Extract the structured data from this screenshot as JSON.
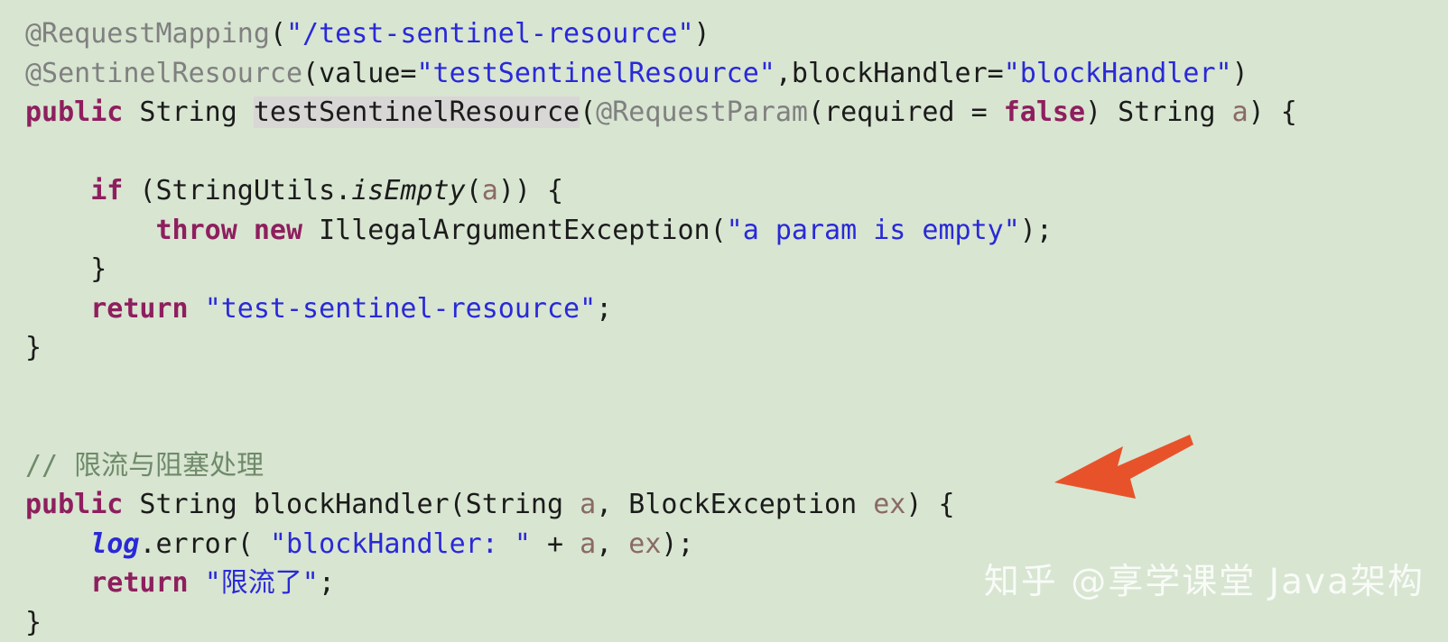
{
  "editor": {
    "background_color": "#d8e5d1",
    "language": "java",
    "font_size_px": 30,
    "theme_colors": {
      "annotation": "#808080",
      "keyword": "#8e1f5e",
      "string": "#2929d8",
      "comment": "#6e8a6a",
      "parameter": "#8a6a63",
      "static_field": "#2929d8",
      "default_text": "#1b1b1b",
      "declaration_highlight": "#d9d6d6"
    }
  },
  "code": {
    "lines": [
      {
        "id": "line-1",
        "plain": "@RequestMapping(\"/test-sentinel-resource\")",
        "tokens": [
          {
            "text": "@RequestMapping",
            "type": "annotation"
          },
          {
            "text": "(",
            "type": "punct"
          },
          {
            "text": "\"/test-sentinel-resource\"",
            "type": "string"
          },
          {
            "text": ")",
            "type": "punct"
          }
        ]
      },
      {
        "id": "line-2",
        "plain": "@SentinelResource(value=\"testSentinelResource\",blockHandler=\"blockHandler\")",
        "tokens": [
          {
            "text": "@SentinelResource",
            "type": "annotation"
          },
          {
            "text": "(value=",
            "type": "punct"
          },
          {
            "text": "\"testSentinelResource\"",
            "type": "string"
          },
          {
            "text": ",blockHandler=",
            "type": "punct"
          },
          {
            "text": "\"blockHandler\"",
            "type": "string"
          },
          {
            "text": ")",
            "type": "punct"
          }
        ]
      },
      {
        "id": "line-3",
        "plain": "public String testSentinelResource(@RequestParam(required = false) String a) {",
        "tokens": [
          {
            "text": "public",
            "type": "keyword"
          },
          {
            "text": " String ",
            "type": "plain"
          },
          {
            "text": "testSentinelResource",
            "type": "declared"
          },
          {
            "text": "(",
            "type": "punct"
          },
          {
            "text": "@RequestParam",
            "type": "annotation"
          },
          {
            "text": "(required = ",
            "type": "plain"
          },
          {
            "text": "false",
            "type": "keyword"
          },
          {
            "text": ") String ",
            "type": "plain"
          },
          {
            "text": "a",
            "type": "param"
          },
          {
            "text": ") {",
            "type": "punct"
          }
        ]
      },
      {
        "id": "line-4",
        "plain": "",
        "tokens": []
      },
      {
        "id": "line-5",
        "plain": "    if (StringUtils.isEmpty(a)) {",
        "tokens": [
          {
            "text": "    ",
            "type": "plain"
          },
          {
            "text": "if",
            "type": "keyword"
          },
          {
            "text": " (StringUtils.",
            "type": "plain"
          },
          {
            "text": "isEmpty",
            "type": "static-method"
          },
          {
            "text": "(",
            "type": "punct"
          },
          {
            "text": "a",
            "type": "param"
          },
          {
            "text": ")) {",
            "type": "punct"
          }
        ]
      },
      {
        "id": "line-6",
        "plain": "        throw new IllegalArgumentException(\"a param is empty\");",
        "tokens": [
          {
            "text": "        ",
            "type": "plain"
          },
          {
            "text": "throw",
            "type": "keyword"
          },
          {
            "text": " ",
            "type": "plain"
          },
          {
            "text": "new",
            "type": "keyword"
          },
          {
            "text": " IllegalArgumentException(",
            "type": "plain"
          },
          {
            "text": "\"a param is empty\"",
            "type": "string"
          },
          {
            "text": ");",
            "type": "punct"
          }
        ]
      },
      {
        "id": "line-7",
        "plain": "    }",
        "tokens": [
          {
            "text": "    }",
            "type": "punct"
          }
        ]
      },
      {
        "id": "line-8",
        "plain": "    return \"test-sentinel-resource\";",
        "tokens": [
          {
            "text": "    ",
            "type": "plain"
          },
          {
            "text": "return",
            "type": "keyword"
          },
          {
            "text": " ",
            "type": "plain"
          },
          {
            "text": "\"test-sentinel-resource\"",
            "type": "string"
          },
          {
            "text": ";",
            "type": "punct"
          }
        ]
      },
      {
        "id": "line-9",
        "plain": "}",
        "tokens": [
          {
            "text": "}",
            "type": "punct"
          }
        ]
      },
      {
        "id": "line-10",
        "plain": "",
        "tokens": []
      },
      {
        "id": "line-11",
        "plain": "",
        "tokens": []
      },
      {
        "id": "line-12",
        "plain": "// 限流与阻塞处理",
        "tokens": [
          {
            "text": "// 限流与阻塞处理",
            "type": "comment"
          }
        ]
      },
      {
        "id": "line-13",
        "plain": "public String blockHandler(String a, BlockException ex) {",
        "tokens": [
          {
            "text": "public",
            "type": "keyword"
          },
          {
            "text": " String blockHandler(String ",
            "type": "plain"
          },
          {
            "text": "a",
            "type": "param"
          },
          {
            "text": ", BlockException ",
            "type": "plain"
          },
          {
            "text": "ex",
            "type": "param"
          },
          {
            "text": ") {",
            "type": "punct"
          }
        ]
      },
      {
        "id": "line-14",
        "plain": "    log.error( \"blockHandler: \" + a, ex);",
        "tokens": [
          {
            "text": "    ",
            "type": "plain"
          },
          {
            "text": "log",
            "type": "static-field"
          },
          {
            "text": ".error( ",
            "type": "plain"
          },
          {
            "text": "\"blockHandler: \"",
            "type": "string"
          },
          {
            "text": " + ",
            "type": "plain"
          },
          {
            "text": "a",
            "type": "param"
          },
          {
            "text": ", ",
            "type": "plain"
          },
          {
            "text": "ex",
            "type": "param"
          },
          {
            "text": ");",
            "type": "punct"
          }
        ]
      },
      {
        "id": "line-15",
        "plain": "    return \"限流了\";",
        "tokens": [
          {
            "text": "    ",
            "type": "plain"
          },
          {
            "text": "return",
            "type": "keyword"
          },
          {
            "text": " ",
            "type": "plain"
          },
          {
            "text": "\"限流了\"",
            "type": "string"
          },
          {
            "text": ";",
            "type": "punct"
          }
        ]
      },
      {
        "id": "line-16",
        "plain": "}",
        "tokens": [
          {
            "text": "}",
            "type": "punct"
          }
        ]
      }
    ]
  },
  "annotations": {
    "arrow": {
      "name": "red-arrow",
      "color": "#e8522a",
      "direction": "left",
      "points_at_line_id": "line-13"
    }
  },
  "watermark": {
    "text": "知乎 @享学课堂 Java架构",
    "color": "rgba(255,255,255,0.82)"
  }
}
